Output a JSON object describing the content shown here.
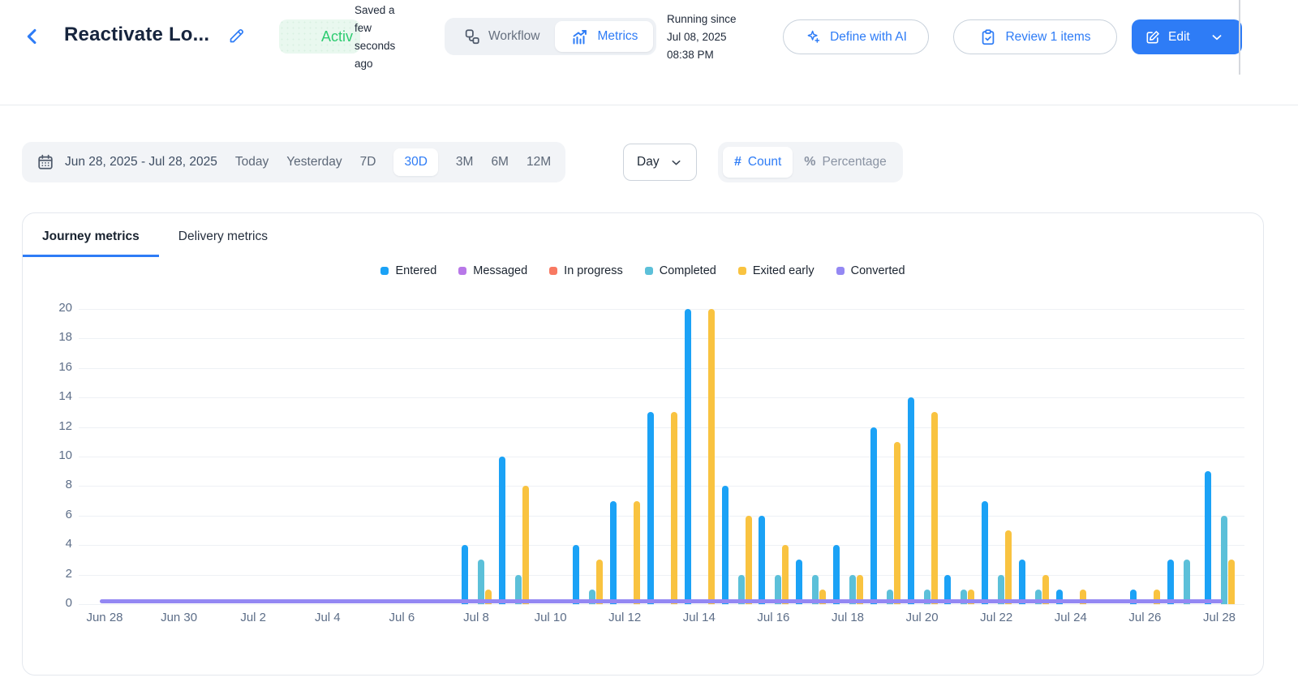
{
  "header": {
    "title": "Reactivate Lo...",
    "status_badge": "Activ",
    "saved_note": "Saved a few seconds ago",
    "toggle": {
      "workflow": "Workflow",
      "metrics": "Metrics",
      "active": "Metrics"
    },
    "running_since": "Running since Jul 08, 2025 08:38 PM",
    "define_ai_label": "Define with AI",
    "review_label": "Review 1 items",
    "edit_label": "Edit"
  },
  "filters": {
    "date_range": "Jun 28, 2025 - Jul 28, 2025",
    "presets": [
      "Today",
      "Yesterday",
      "7D",
      "30D",
      "3M",
      "6M",
      "12M"
    ],
    "active_preset": "30D",
    "granularity": "Day",
    "modes": [
      {
        "label": "Count",
        "glyph": "#",
        "active": true
      },
      {
        "label": "Percentage",
        "glyph": "%",
        "active": false
      }
    ]
  },
  "tabs": {
    "journey": "Journey metrics",
    "delivery": "Delivery metrics",
    "active": "Journey metrics"
  },
  "chart_data": {
    "type": "bar",
    "title": "Journey metrics by day",
    "xlabel": "",
    "ylabel": "",
    "ylim": [
      0,
      20
    ],
    "y_ticks": [
      0,
      2,
      4,
      6,
      8,
      10,
      12,
      14,
      16,
      18,
      20
    ],
    "grid": true,
    "legend_position": "top",
    "categories": [
      "Jun 28",
      "Jun 29",
      "Jun 30",
      "Jul 1",
      "Jul 2",
      "Jul 3",
      "Jul 4",
      "Jul 5",
      "Jul 6",
      "Jul 7",
      "Jul 8",
      "Jul 9",
      "Jul 10",
      "Jul 11",
      "Jul 12",
      "Jul 13",
      "Jul 14",
      "Jul 15",
      "Jul 16",
      "Jul 17",
      "Jul 18",
      "Jul 19",
      "Jul 20",
      "Jul 21",
      "Jul 22",
      "Jul 23",
      "Jul 24",
      "Jul 25",
      "Jul 26",
      "Jul 27",
      "Jul 28"
    ],
    "x_tick_labels": [
      "Jun 28",
      "Jun 30",
      "Jul 2",
      "Jul 4",
      "Jul 6",
      "Jul 8",
      "Jul 10",
      "Jul 12",
      "Jul 14",
      "Jul 16",
      "Jul 18",
      "Jul 20",
      "Jul 22",
      "Jul 24",
      "Jul 26",
      "Jul 28"
    ],
    "series": [
      {
        "name": "Entered",
        "color": "#1ba2f6",
        "values": [
          0,
          0,
          0,
          0,
          0,
          0,
          0,
          0,
          0,
          0,
          4,
          10,
          0,
          4,
          7,
          13,
          20,
          8,
          6,
          3,
          4,
          12,
          14,
          2,
          7,
          3,
          1,
          0,
          1,
          3,
          9
        ]
      },
      {
        "name": "Messaged",
        "color": "#b878e8",
        "values": [
          0,
          0,
          0,
          0,
          0,
          0,
          0,
          0,
          0,
          0,
          0,
          0,
          0,
          0,
          0,
          0,
          0,
          0,
          0,
          0,
          0,
          0,
          0,
          0,
          0,
          0,
          0,
          0,
          0,
          0,
          0
        ]
      },
      {
        "name": "In progress",
        "color": "#f87962",
        "values": [
          0,
          0,
          0,
          0,
          0,
          0,
          0,
          0,
          0,
          0,
          0,
          0,
          0,
          0,
          0,
          0,
          0,
          0,
          0,
          0,
          0,
          0,
          0,
          0,
          0,
          0,
          0,
          0,
          0,
          0,
          0
        ]
      },
      {
        "name": "Completed",
        "color": "#5cc0d9",
        "values": [
          0,
          0,
          0,
          0,
          0,
          0,
          0,
          0,
          0,
          0,
          3,
          2,
          0,
          1,
          0,
          0,
          0,
          2,
          2,
          2,
          2,
          1,
          1,
          1,
          2,
          1,
          0,
          0,
          0,
          3,
          6
        ]
      },
      {
        "name": "Exited early",
        "color": "#f9c340",
        "values": [
          0,
          0,
          0,
          0,
          0,
          0,
          0,
          0,
          0,
          0,
          1,
          8,
          0,
          3,
          7,
          13,
          20,
          6,
          4,
          1,
          2,
          11,
          13,
          1,
          5,
          2,
          1,
          0,
          1,
          0,
          3
        ]
      },
      {
        "name": "Converted",
        "color": "#9488f3",
        "render": "baseline",
        "values": [
          0,
          0,
          0,
          0,
          0,
          0,
          0,
          0,
          0,
          0,
          0,
          0,
          0,
          0,
          0,
          0,
          0,
          0,
          0,
          0,
          0,
          0,
          0,
          0,
          0,
          0,
          0,
          0,
          0,
          0,
          0
        ]
      }
    ]
  },
  "colors": {
    "accent_blue": "#2e7cf6",
    "badge_green": "#2ecc71",
    "badge_bg": "#e9f8ef",
    "gridline": "#eef1f5",
    "axis_text": "#5d6e88"
  }
}
